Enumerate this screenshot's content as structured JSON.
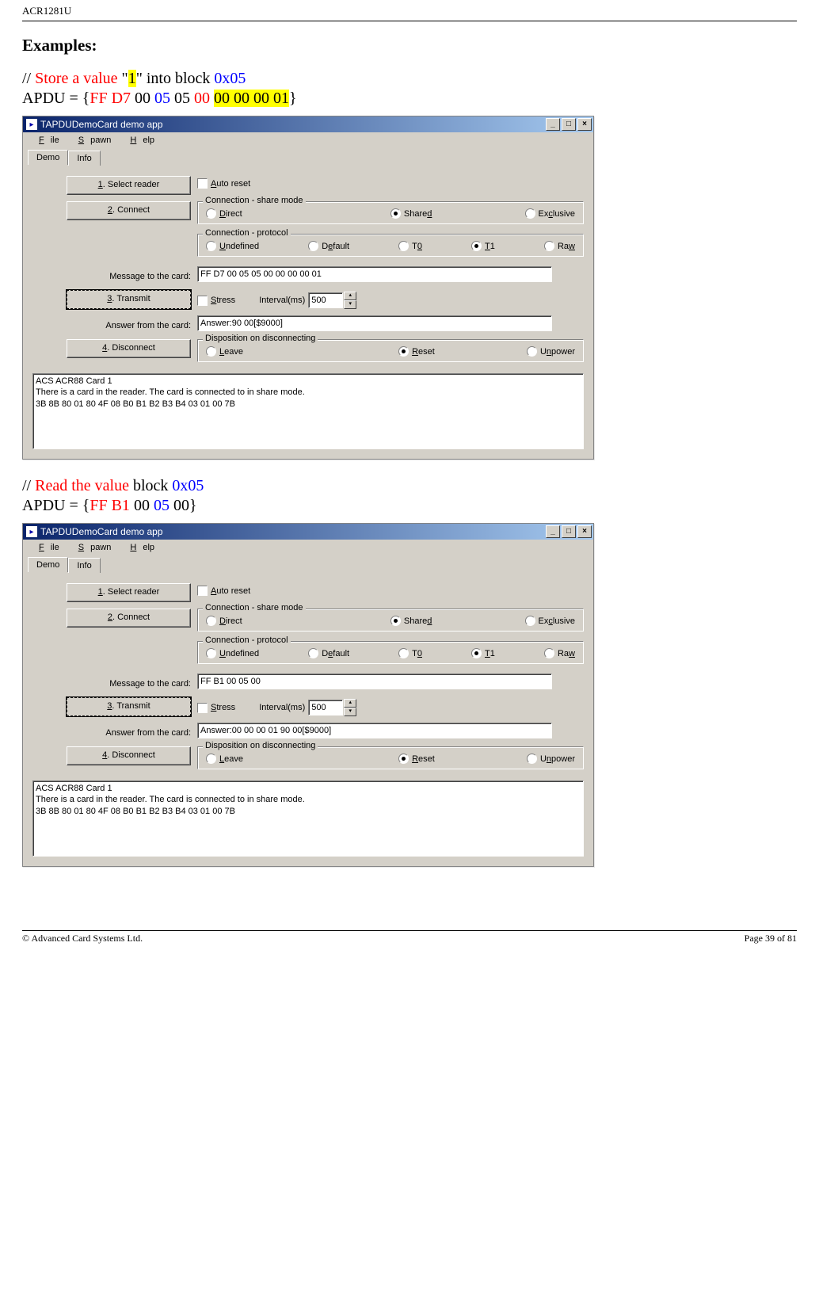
{
  "header": {
    "product": "ACR1281U"
  },
  "sections": {
    "title": "Examples:",
    "ex1": {
      "comment_slashes": "// ",
      "comment_red": "Store a value ",
      "comment_quote1": "\"",
      "comment_value": "1",
      "comment_quote2": "\" into block ",
      "comment_block": "0x05",
      "apdu_prefix": "APDU = {",
      "apdu_red": "FF D7",
      "apdu_mid1": " 00 ",
      "apdu_blue": "05",
      "apdu_mid2": " 05 ",
      "apdu_red2": "00",
      "apdu_space": " ",
      "apdu_hl": "00 00 00 01",
      "apdu_suffix": "}"
    },
    "ex2": {
      "comment_slashes": "// ",
      "comment_red": "Read the value ",
      "comment_mid": "block ",
      "comment_block": "0x05",
      "apdu_prefix": "APDU = {",
      "apdu_red": "FF B1",
      "apdu_mid1": " 00 ",
      "apdu_blue": "05",
      "apdu_mid2": " 00",
      "apdu_suffix": "}"
    }
  },
  "app_common": {
    "title": "TAPDUDemoCard demo app",
    "menu": {
      "file": "File",
      "spawn": "Spawn",
      "help": "Help"
    },
    "tabs": {
      "demo": "Demo",
      "info": "Info"
    },
    "buttons": {
      "select": "1. Select reader",
      "connect": "2. Connect",
      "transmit": "3. Transmit",
      "disconnect": "4. Disconnect"
    },
    "labels": {
      "auto_reset": "Auto reset",
      "share_mode": "Connection - share mode",
      "direct": "Direct",
      "shared": "Shared",
      "exclusive": "Exclusive",
      "protocol": "Connection - protocol",
      "undefined": "Undefined",
      "default": "Default",
      "t0": "T0",
      "t1": "T1",
      "raw": "Raw",
      "msg_to": "Message to the card:",
      "stress": "Stress",
      "interval": "Interval(ms)",
      "interval_val": "500",
      "answer_from": "Answer from the card:",
      "disposition": "Disposition on disconnecting",
      "leave": "Leave",
      "reset": "Reset",
      "unpower": "Unpower"
    },
    "log": "ACS ACR88 Card 1\nThere is a card in the reader. The card is connected to in share mode.\n3B 8B 80 01 80 4F 08 B0 B1 B2 B3 B4 03 01 00 7B"
  },
  "app1": {
    "message": "FF D7 00 05 05 00 00 00 00 01",
    "answer": "Answer:90 00[$9000]"
  },
  "app2": {
    "message": "FF B1 00 05 00",
    "answer": "Answer:00 00 00 01 90 00[$9000]"
  },
  "footer": {
    "left": "© Advanced Card Systems Ltd.",
    "right": "Page 39 of 81"
  }
}
